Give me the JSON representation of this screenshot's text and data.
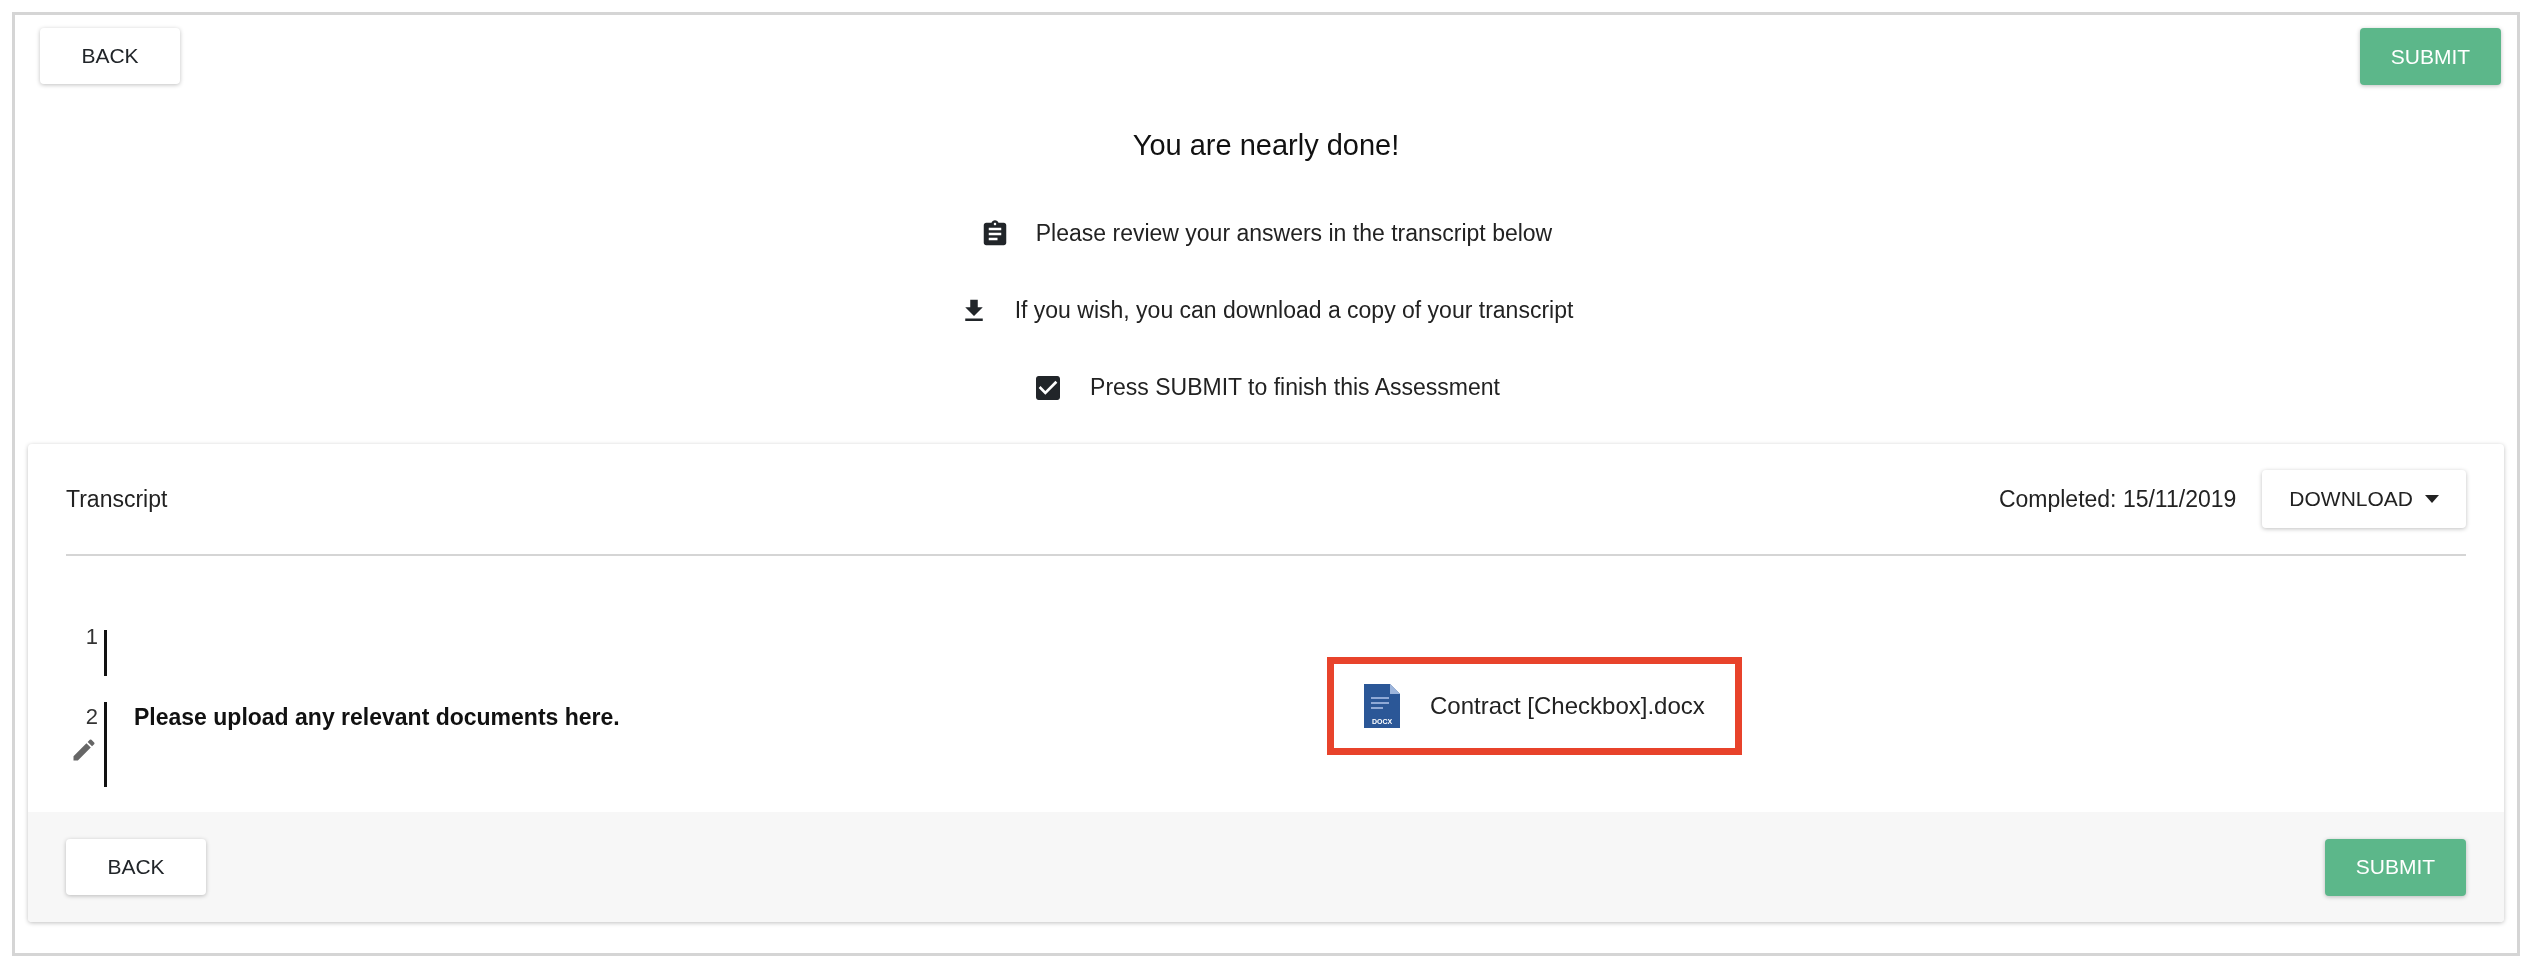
{
  "top_bar": {
    "back": "BACK",
    "submit": "SUBMIT"
  },
  "heading": "You are nearly done!",
  "steps": [
    {
      "kind": "clipboard",
      "text": "Please review your answers in the transcript below"
    },
    {
      "kind": "download",
      "text": "If you wish, you can download a copy of your transcript"
    },
    {
      "kind": "checkbox",
      "text": "Press SUBMIT to finish this Assessment"
    }
  ],
  "transcript": {
    "title": "Transcript",
    "completed": "Completed: 15/11/2019",
    "download": "DOWNLOAD",
    "rows": [
      {
        "number": "1",
        "editable": false
      },
      {
        "number": "2",
        "editable": true,
        "question": "Please upload any relevant documents here.",
        "attachment": {
          "name": "Contract [Checkbox].docx",
          "icon_label": "DOCX",
          "highlighted": true
        }
      }
    ]
  },
  "footer": {
    "back": "BACK",
    "submit": "SUBMIT"
  }
}
